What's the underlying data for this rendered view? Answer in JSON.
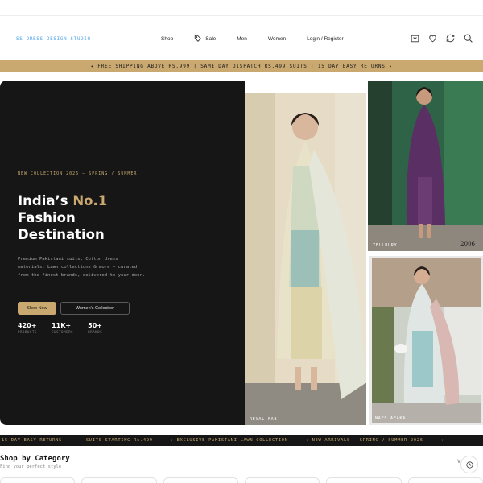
{
  "brand": {
    "logo_text": "SS DRESS DESIGN STUDIO"
  },
  "nav": {
    "items": [
      {
        "label": "Shop"
      },
      {
        "label": "Sale"
      },
      {
        "label": "Men"
      },
      {
        "label": "Women"
      },
      {
        "label": "Login / Register"
      }
    ]
  },
  "header_icons": [
    "cart-icon",
    "heart-icon",
    "compare-icon",
    "search-icon"
  ],
  "promo_bar": {
    "text": "✦ FREE SHIPPING ABOVE RS.999  |  SAME DAY DISPATCH RS.499 SUITS  |  15 DAY EASY RETURNS ✦"
  },
  "hero": {
    "eyebrow": "NEW COLLECTION 2026 — SPRING / SUMMER",
    "headline_line1_prefix": "India’s ",
    "headline_line1_highlight": "No.1",
    "headline_line2": "Fashion",
    "headline_line3": "Destination",
    "description": "Premium Pakistani suits, Cotton dress materials, Lawn collections & more — curated from the finest brands, delivered to your door.",
    "primary_button": "Shop Now",
    "secondary_button": "Women's Collection",
    "stats": [
      {
        "value": "420+",
        "label": "PRODUCTS"
      },
      {
        "value": "11K+",
        "label": "CUSTOMERS"
      },
      {
        "value": "50+",
        "label": "BRANDS"
      }
    ],
    "images": {
      "main_label": "REVAL FAB",
      "top_right_label": "ZELLBURY",
      "top_right_year": "2006",
      "bottom_right_label": "NAFS AFAKA"
    }
  },
  "ticker": {
    "items": [
      "15 DAY EASY RETURNS",
      "✦ SUITS STARTING Rs.499",
      "✦ EXCLUSIVE PAKISTANI LAWN COLLECTION",
      "✦ NEW ARRIVALS — SPRING / SUMMER 2026",
      "✦"
    ]
  },
  "categories": {
    "title": "Shop by Category",
    "subtitle": "Find your perfect style",
    "v_label": "V"
  },
  "colors": {
    "gold": "#c9a970",
    "dark": "#161616",
    "logo_blue": "#4da3e6"
  }
}
